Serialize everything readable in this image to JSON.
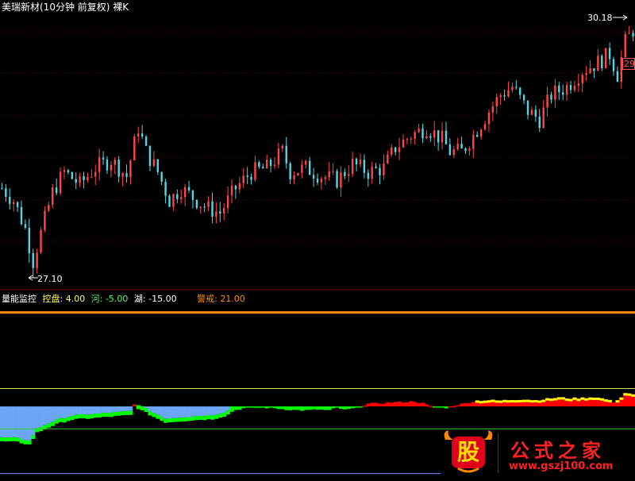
{
  "header": {
    "title": "美瑞新材(10分钟 前复权) 裸K"
  },
  "price_panel": {
    "high_label": "30.18",
    "last_label": "29.",
    "low_label": "27.10"
  },
  "indicator_panel": {
    "name": "量能监控",
    "params": [
      {
        "label": "控盘:",
        "value": "4.00",
        "color": "#ffff55"
      },
      {
        "label": "河:",
        "value": "-5.00",
        "color": "#55ff55"
      },
      {
        "label": "湖:",
        "value": "-15.00",
        "color": "#ffffff"
      },
      {
        "label": "警戒:",
        "value": "21.00",
        "color": "#ff8c00"
      }
    ]
  },
  "watermark": {
    "logo_char": "股",
    "text": "公式之家",
    "url": "www.gszj100.com"
  },
  "colors": {
    "up": "#ff4545",
    "down": "#54d6e6",
    "grid": "#4a0000",
    "warning_line": "#ff8c00",
    "control_line": "#dddd55",
    "river_line": "#33cc33",
    "bar_green": "#00ff00",
    "bar_red": "#ff0000",
    "bar_yellow": "#ffff00",
    "bar_blue": "#6aa6f5"
  },
  "chart_data": [
    {
      "type": "candlestick",
      "title": "美瑞新材(10分钟 前复权) 裸K",
      "annotations": [
        "30.18",
        "27.10"
      ],
      "ylim": [
        26.9,
        30.3
      ],
      "waypoints": [
        [
          0,
          28.1
        ],
        [
          3,
          27.95
        ],
        [
          6,
          27.6
        ],
        [
          8,
          27.2
        ],
        [
          10,
          27.55
        ],
        [
          13,
          28.05
        ],
        [
          16,
          28.3
        ],
        [
          20,
          28.15
        ],
        [
          24,
          28.35
        ],
        [
          28,
          28.45
        ],
        [
          32,
          28.25
        ],
        [
          35,
          28.85
        ],
        [
          37,
          28.55
        ],
        [
          40,
          28.3
        ],
        [
          43,
          27.95
        ],
        [
          46,
          28.1
        ],
        [
          50,
          27.95
        ],
        [
          53,
          27.85
        ],
        [
          56,
          27.8
        ],
        [
          60,
          28.1
        ],
        [
          64,
          28.3
        ],
        [
          68,
          28.35
        ],
        [
          72,
          28.55
        ],
        [
          74,
          28.3
        ],
        [
          78,
          28.35
        ],
        [
          82,
          28.25
        ],
        [
          86,
          28.2
        ],
        [
          90,
          28.4
        ],
        [
          94,
          28.3
        ],
        [
          98,
          28.35
        ],
        [
          101,
          28.6
        ],
        [
          105,
          28.75
        ],
        [
          109,
          28.85
        ],
        [
          113,
          28.7
        ],
        [
          115,
          28.55
        ],
        [
          118,
          28.55
        ],
        [
          121,
          28.75
        ],
        [
          125,
          29.05
        ],
        [
          128,
          29.25
        ],
        [
          131,
          29.35
        ],
        [
          135,
          29.05
        ],
        [
          138,
          28.95
        ],
        [
          141,
          29.25
        ],
        [
          145,
          29.35
        ],
        [
          149,
          29.55
        ],
        [
          153,
          29.65
        ],
        [
          156,
          29.75
        ],
        [
          158,
          29.5
        ],
        [
          160,
          29.9
        ],
        [
          162,
          30.05
        ]
      ],
      "candle_count": 163
    },
    {
      "type": "bar",
      "series_name": "量能监控",
      "reference_lines": [
        {
          "name": "警戒",
          "value": 21.0
        },
        {
          "name": "控盘",
          "value": 4.0
        },
        {
          "name": "河",
          "value": -5.0
        },
        {
          "name": "湖",
          "value": -15.0
        }
      ],
      "ylim": [
        -15.6,
        22.0
      ],
      "waypoints": [
        [
          0,
          -7.5
        ],
        [
          4,
          -7.6
        ],
        [
          7,
          -8.2
        ],
        [
          9,
          -5.5
        ],
        [
          12,
          -4.3
        ],
        [
          15,
          -3.3
        ],
        [
          18,
          -2.6
        ],
        [
          21,
          -2.4
        ],
        [
          24,
          -2.2
        ],
        [
          27,
          -2.0
        ],
        [
          30,
          -1.8
        ],
        [
          33,
          -1.6
        ],
        [
          34,
          0.4
        ],
        [
          36,
          -0.6
        ],
        [
          39,
          -2.0
        ],
        [
          42,
          -3.2
        ],
        [
          45,
          -3.0
        ],
        [
          48,
          -2.8
        ],
        [
          51,
          -2.6
        ],
        [
          54,
          -2.5
        ],
        [
          57,
          -1.8
        ],
        [
          60,
          -0.8
        ],
        [
          63,
          -0.2
        ],
        [
          66,
          -0.3
        ],
        [
          69,
          -0.3
        ],
        [
          72,
          -0.6
        ],
        [
          75,
          -0.8
        ],
        [
          78,
          -0.9
        ],
        [
          81,
          -0.7
        ],
        [
          84,
          -0.9
        ],
        [
          86,
          -0.2
        ],
        [
          88,
          -0.8
        ],
        [
          91,
          -0.3
        ],
        [
          94,
          0.6
        ],
        [
          97,
          0.7
        ],
        [
          100,
          0.9
        ],
        [
          103,
          1.0
        ],
        [
          106,
          1.1
        ],
        [
          108,
          0.7
        ],
        [
          110,
          0.0
        ],
        [
          112,
          -0.2
        ],
        [
          114,
          -0.3
        ],
        [
          116,
          0.2
        ],
        [
          119,
          0.7
        ],
        [
          122,
          1.3
        ],
        [
          125,
          1.4
        ],
        [
          128,
          1.3
        ],
        [
          131,
          1.5
        ],
        [
          134,
          1.6
        ],
        [
          137,
          1.4
        ],
        [
          140,
          1.7
        ],
        [
          143,
          2.0
        ],
        [
          146,
          1.8
        ],
        [
          149,
          1.9
        ],
        [
          152,
          2.1
        ],
        [
          155,
          1.6
        ],
        [
          157,
          1.0
        ],
        [
          159,
          2.0
        ],
        [
          160,
          3.0
        ],
        [
          162,
          2.6
        ]
      ],
      "blue_gap_region": [
        0,
        58
      ]
    }
  ]
}
